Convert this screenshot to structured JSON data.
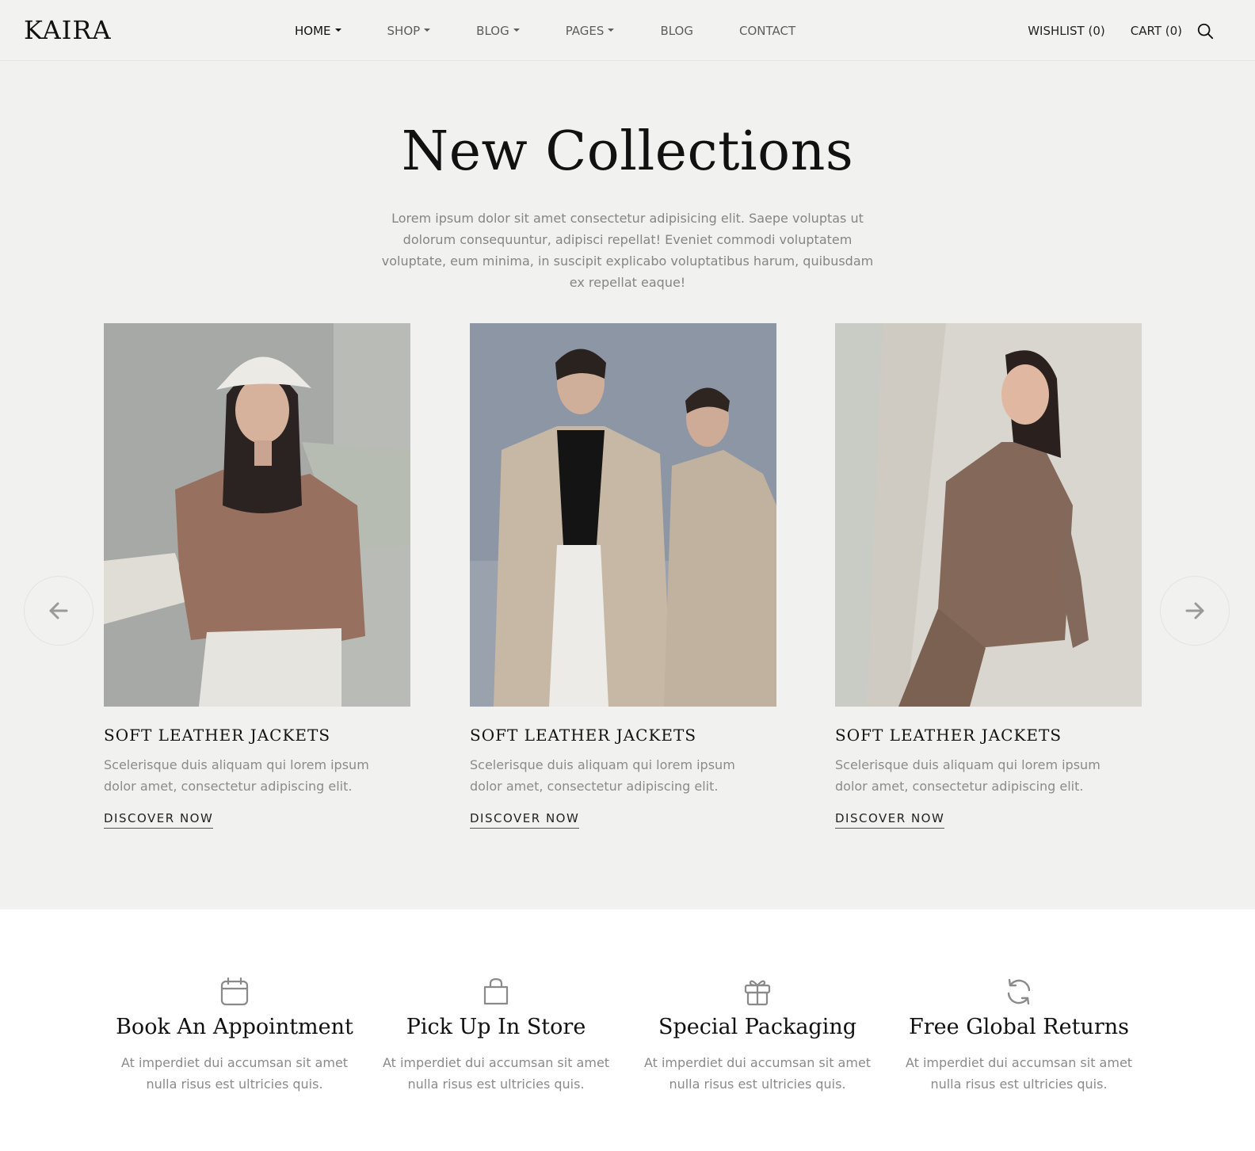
{
  "header": {
    "logo": "KAIRA",
    "nav": [
      {
        "label": "HOME",
        "dropdown": true,
        "active": true
      },
      {
        "label": "SHOP",
        "dropdown": true,
        "active": false
      },
      {
        "label": "BLOG",
        "dropdown": true,
        "active": false
      },
      {
        "label": "PAGES",
        "dropdown": true,
        "active": false
      },
      {
        "label": "BLOG",
        "dropdown": false,
        "active": false
      },
      {
        "label": "CONTACT",
        "dropdown": false,
        "active": false
      }
    ],
    "wishlist": "WISHLIST (0)",
    "cart": "CART (0)",
    "search_icon": "search-icon"
  },
  "collections": {
    "title": "New Collections",
    "description": "Lorem ipsum dolor sit amet consectetur adipisicing elit. Saepe voluptas ut dolorum consequuntur, adipisci repellat! Eveniet commodi voluptatem voluptate, eum minima, in suscipit explicabo voluptatibus harum, quibusdam ex repellat eaque!",
    "cards": [
      {
        "title": "SOFT LEATHER JACKETS",
        "text": "Scelerisque duis aliquam qui lorem ipsum dolor amet, consectetur adipiscing elit.",
        "link": "DISCOVER NOW"
      },
      {
        "title": "SOFT LEATHER JACKETS",
        "text": "Scelerisque duis aliquam qui lorem ipsum dolor amet, consectetur adipiscing elit.",
        "link": "DISCOVER NOW"
      },
      {
        "title": "SOFT LEATHER JACKETS",
        "text": "Scelerisque duis aliquam qui lorem ipsum dolor amet, consectetur adipiscing elit.",
        "link": "DISCOVER NOW"
      }
    ],
    "prev_icon": "arrow-left-icon",
    "next_icon": "arrow-right-icon"
  },
  "features": [
    {
      "icon": "calendar-icon",
      "title": "Book An Appointment",
      "text": "At imperdiet dui accumsan sit amet nulla risus est ultricies quis."
    },
    {
      "icon": "shopping-bag-icon",
      "title": "Pick Up In Store",
      "text": "At imperdiet dui accumsan sit amet nulla risus est ultricies quis."
    },
    {
      "icon": "gift-icon",
      "title": "Special Packaging",
      "text": "At imperdiet dui accumsan sit amet nulla risus est ultricies quis."
    },
    {
      "icon": "refresh-icon",
      "title": "Free Global Returns",
      "text": "At imperdiet dui accumsan sit amet nulla risus est ultricies quis."
    }
  ],
  "colors": {
    "page_bg": "#f1f1ef",
    "text_dark": "#111111",
    "text_muted": "#8a8a8a"
  }
}
